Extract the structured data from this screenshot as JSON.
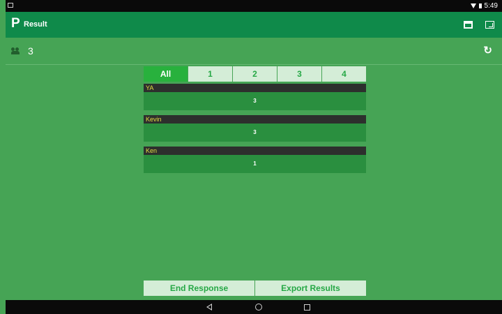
{
  "status_bar": {
    "time": "5:49"
  },
  "app_bar": {
    "logo": "P",
    "title": "Result"
  },
  "info_bar": {
    "participant_count": "3"
  },
  "tabs": [
    {
      "label": "All",
      "active": true
    },
    {
      "label": "1",
      "active": false
    },
    {
      "label": "2",
      "active": false
    },
    {
      "label": "3",
      "active": false
    },
    {
      "label": "4",
      "active": false
    }
  ],
  "responses": [
    {
      "name": "YA",
      "value": "3"
    },
    {
      "name": "Kevin",
      "value": "3"
    },
    {
      "name": "Ken",
      "value": "1"
    }
  ],
  "actions": {
    "end_label": "End Response",
    "export_label": "Export Results"
  },
  "colors": {
    "background": "#46a455",
    "app_bar": "#0f8a4a",
    "tab_active": "#28b13d",
    "name_text": "#e3dd42"
  }
}
